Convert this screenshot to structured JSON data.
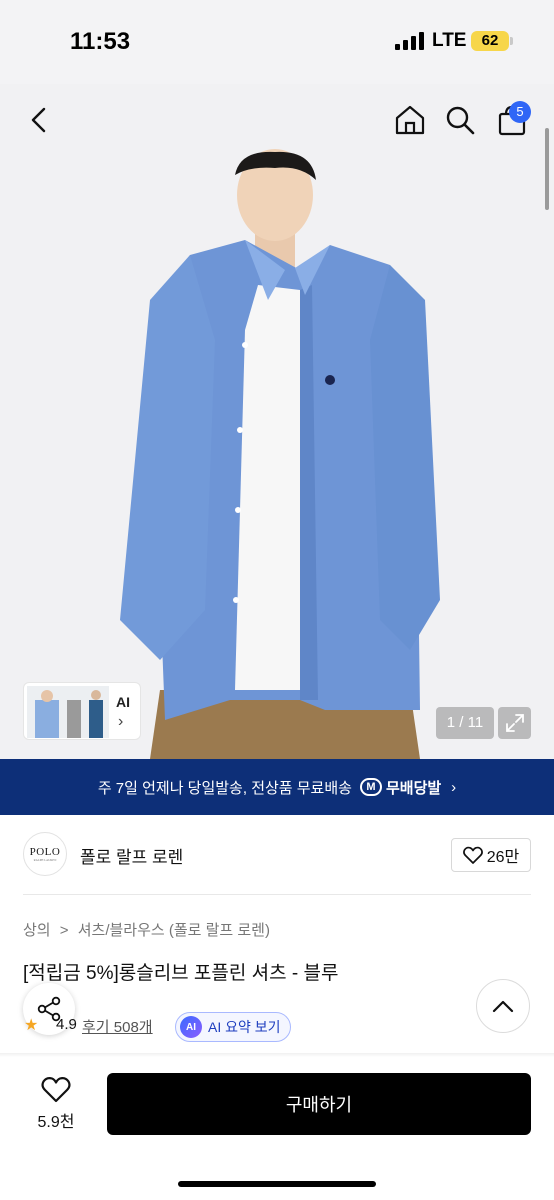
{
  "status_bar": {
    "time": "11:53",
    "network": "LTE",
    "battery": "62"
  },
  "nav": {
    "back_icon": "chevron-left-icon",
    "home_icon": "home-icon",
    "search_icon": "search-icon",
    "cart_icon": "shopping-bag-icon",
    "cart_count": "5"
  },
  "gallery": {
    "ai_label": "AI",
    "ai_chevron": "›",
    "counter": "1 / 11",
    "expand_icon": "expand-icon"
  },
  "banner": {
    "text": "주 7일 언제나 당일발송, 전상품 무료배송",
    "badge_mark": "M",
    "badge_label": "무배당발",
    "chevron": "›"
  },
  "brand": {
    "logo_text": "POLO",
    "logo_subtext": "RALPH LAUREN",
    "name": "폴로 랄프 로렌",
    "like_count": "26만"
  },
  "breadcrumb": {
    "category": "상의",
    "separator": ">",
    "subcategory": "셔츠/블라우스 (폴로 랄프 로렌)"
  },
  "product": {
    "title": "[적립금 5%]롱슬리브 포플린 셔츠 - 블루",
    "rating": "4.9",
    "reviews": "후기 508개",
    "ai_badge": "AI",
    "ai_summary": "AI 요약 보기"
  },
  "bottom_bar": {
    "wish_count": "5.9천",
    "buy_label": "구매하기"
  },
  "colors": {
    "banner_bg": "#0d2f78",
    "accent_blue": "#2f66f6",
    "buy_button": "#000000",
    "battery": "#f7d64a"
  }
}
